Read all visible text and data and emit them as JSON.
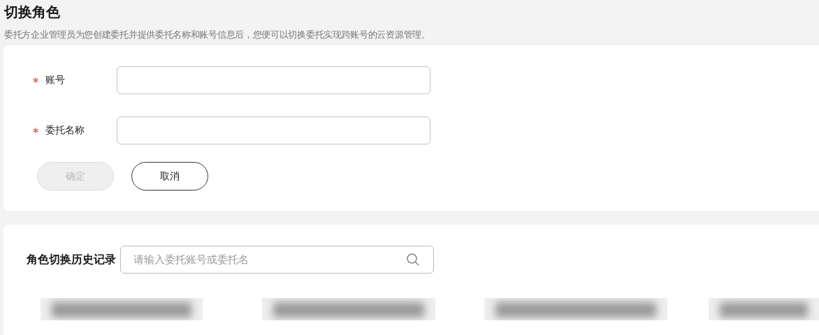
{
  "title": "切换角色",
  "description": "委托方企业管理员为您创建委托并提供委托名称和账号信息后，您便可以切换委托实现跨账号的云资源管理。",
  "form": {
    "fields": [
      {
        "label": "账号",
        "required": true
      },
      {
        "label": "委托名称",
        "required": true
      }
    ],
    "buttons": [
      {
        "label": "确定",
        "disabled": true
      },
      {
        "label": "取消",
        "disabled": false
      }
    ]
  },
  "history": {
    "title": "角色切换历史记录",
    "search": {
      "placeholder": "请输入委托账号或委托名"
    }
  }
}
